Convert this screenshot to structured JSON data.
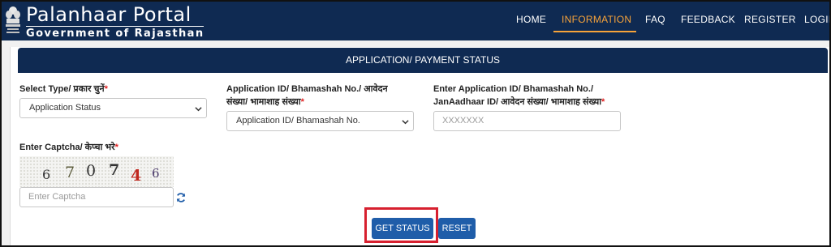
{
  "header": {
    "brand_title": "Palanhaar Portal",
    "brand_subtitle": "Government of Rajasthan",
    "nav": [
      {
        "label": "HOME",
        "active": false
      },
      {
        "label": "INFORMATION",
        "active": true
      },
      {
        "label": "FAQ",
        "active": false
      },
      {
        "label": "FEEDBACK",
        "active": false
      },
      {
        "label": "REGISTER",
        "active": false
      },
      {
        "label": "LOGIN",
        "active": false
      }
    ]
  },
  "panel": {
    "title": "APPLICATION/ PAYMENT STATUS"
  },
  "form": {
    "select_type": {
      "label": "Select Type/ प्रकार चुनें",
      "required_mark": "*",
      "value": "Application Status"
    },
    "id_type": {
      "label_line1": "Application ID/ Bhamashah No./ आवेदन",
      "label_line2": "संख्या/ भामाशाह संख्या",
      "required_mark": "*",
      "value": "Application ID/ Bhamashah No."
    },
    "id_input": {
      "label_line1": "Enter Application ID/ Bhamashah No./",
      "label_line2": "JanAadhaar ID/ आवेदन संख्या/ भामाशाह संख्या",
      "required_mark": "*",
      "placeholder": "XXXXXXX"
    },
    "captcha": {
      "label": "Enter Captcha/ केप्चा भरे",
      "required_mark": "*",
      "characters": [
        "6",
        "7",
        "0",
        "7",
        "4",
        "6"
      ],
      "placeholder": "Enter Captcha"
    },
    "buttons": {
      "get_status": "GET STATUS",
      "reset": "RESET"
    }
  },
  "colors": {
    "header_bg": "#0f2a52",
    "accent": "#f7a33a",
    "button_bg": "#1f5da9",
    "required": "#e02020",
    "highlight": "#d7202f"
  },
  "icons": [
    "state-emblem-icon",
    "chevron-down-icon",
    "refresh-icon"
  ]
}
